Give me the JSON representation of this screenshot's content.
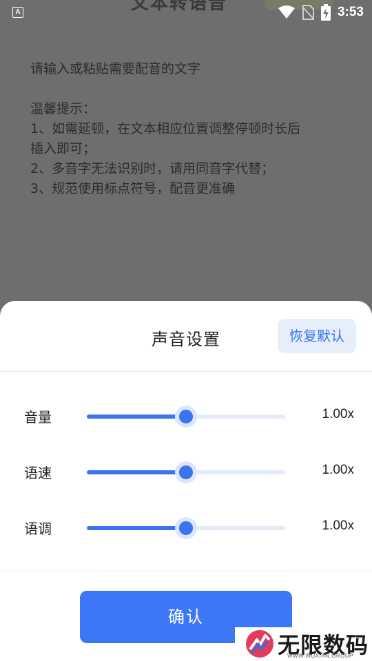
{
  "status_bar": {
    "notification_icon": "font-a-icon",
    "time": "3:53"
  },
  "background": {
    "header_title_partial": "文本转语音",
    "editor_placeholder": [
      "请输入或粘贴需要配音的文字",
      "",
      "温馨提示：",
      "1、如需延顿，在文本相应位置调整停顿时长后",
      "插入即可；",
      "2、多音字无法识别时，请用同音字代替；",
      "3、规范使用标点符号，配音更准确"
    ]
  },
  "sheet": {
    "title": "声音设置",
    "reset_label": "恢复默认",
    "sliders": [
      {
        "label": "音量",
        "value_text": "1.00x",
        "position": 0.5
      },
      {
        "label": "语速",
        "value_text": "1.00x",
        "position": 0.5
      },
      {
        "label": "语调",
        "value_text": "1.00x",
        "position": 0.5
      }
    ],
    "confirm_label": "确认"
  },
  "watermark": {
    "text": "无限数码",
    "sub": "WWW.WUXIAN.GROUP"
  },
  "colors": {
    "accent": "#3b73f0",
    "overlay": "#6e6e6e",
    "reset_bg": "#e6eefc"
  }
}
